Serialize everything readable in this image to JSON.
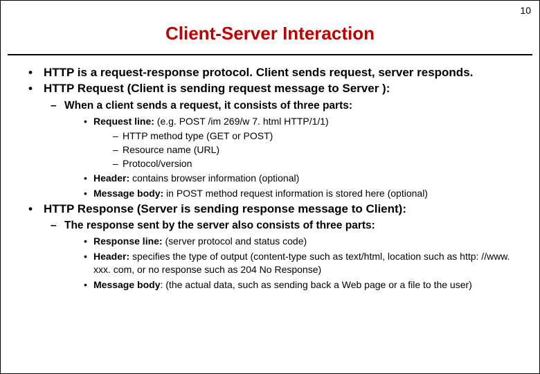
{
  "page_number": "10",
  "title": "Client-Server Interaction",
  "bullets": {
    "b1": "HTTP is a request-response protocol. Client sends request, server responds.",
    "b2": "HTTP Request (Client is sending request message to Server ):",
    "b2_1": "When a client sends a request, it  consists of three parts:",
    "b2_1_1_label": "Request line:",
    "b2_1_1_rest": " (e.g. POST /im 269/w 7. html HTTP/1/1)",
    "b2_1_1_a": "HTTP method type (GET or POST)",
    "b2_1_1_b": "Resource name (URL)",
    "b2_1_1_c": "Protocol/version",
    "b2_1_2_label": "Header:",
    "b2_1_2_rest": " contains browser information (optional)",
    "b2_1_3_label": "Message body:",
    "b2_1_3_rest": " in POST method request information is stored here (optional)",
    "b3": "HTTP Response (Server is sending response message to Client):",
    "b3_1": "The response sent by the server also consists of three parts:",
    "b3_1_1_label": "Response line:",
    "b3_1_1_rest": " (server protocol and status code)",
    "b3_1_2_label": "Header:",
    "b3_1_2_rest": " specifies the type of output (content-type such as text/html, location such as http: //www. xxx. com, or no response such as 204 No Response)",
    "b3_1_3_label": "Message body",
    "b3_1_3_rest": ": (the actual data, such as sending back a Web page or a file to the user)"
  }
}
